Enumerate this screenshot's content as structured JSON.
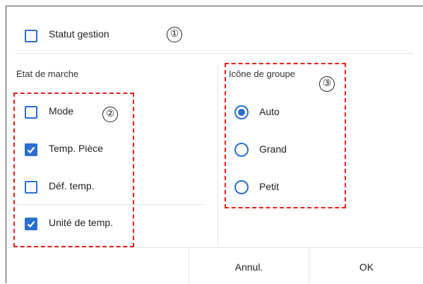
{
  "header": {
    "statut_checkbox": {
      "label": "Statut gestion",
      "checked": false
    },
    "marker": "①"
  },
  "etat": {
    "title": "Etat de marche",
    "marker": "②",
    "items": [
      {
        "label": "Mode",
        "checked": false
      },
      {
        "label": "Temp. Pièce",
        "checked": true
      },
      {
        "label": "Déf. temp.",
        "checked": false
      },
      {
        "label": "Unité de temp.",
        "checked": true
      }
    ]
  },
  "icone": {
    "title": "Icône de groupe",
    "marker": "③",
    "options": [
      {
        "label": "Auto",
        "selected": true
      },
      {
        "label": "Grand",
        "selected": false
      },
      {
        "label": "Petit",
        "selected": false
      }
    ]
  },
  "footer": {
    "cancel_label": "Annul.",
    "ok_label": "OK"
  },
  "colors": {
    "accent": "#2b6fd0",
    "annotation": "#e2231a"
  }
}
